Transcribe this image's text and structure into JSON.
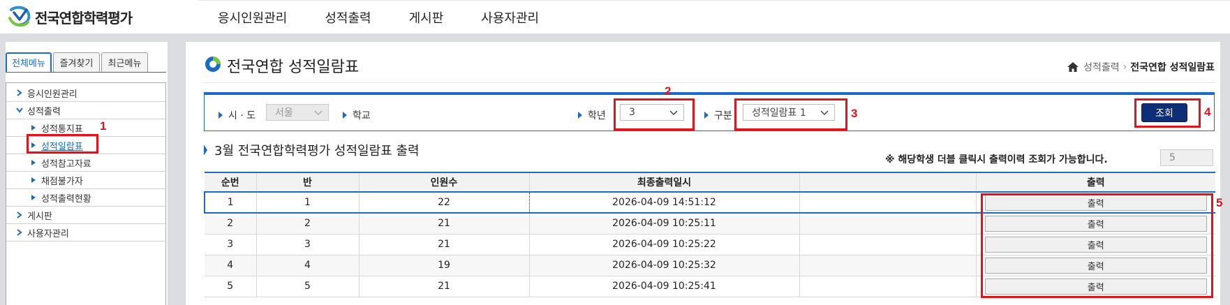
{
  "header": {
    "logo_text": "전국연합학력평가",
    "nav": [
      "응시인원관리",
      "성적출력",
      "게시판",
      "사용자관리"
    ]
  },
  "sidebar": {
    "tabs": [
      "전체메뉴",
      "즐겨찾기",
      "최근메뉴"
    ],
    "menu": [
      {
        "label": "응시인원관리",
        "level": 1,
        "expanded": false
      },
      {
        "label": "성적출력",
        "level": 1,
        "expanded": true
      },
      {
        "label": "성적통지표",
        "level": 2
      },
      {
        "label": "성적일람표",
        "level": 2,
        "selected": true
      },
      {
        "label": "성적참고자료",
        "level": 2
      },
      {
        "label": "채점불가자",
        "level": 2
      },
      {
        "label": "성적출력현황",
        "level": 2
      },
      {
        "label": "게시판",
        "level": 1,
        "expanded": false
      },
      {
        "label": "사용자관리",
        "level": 1,
        "expanded": false
      }
    ]
  },
  "page": {
    "title": "전국연합 성적일람표",
    "breadcrumb": [
      "성적출력",
      "전국연합 성적일람표"
    ]
  },
  "filter": {
    "sido_label": "시 · 도",
    "sido_value": "서울",
    "school_label": "학교",
    "grade_label": "학년",
    "grade_value": "3",
    "type_label": "구분",
    "type_value": "성적일람표 1",
    "search_label": "조회"
  },
  "result": {
    "subtitle": "3월 전국연합학력평가 성적일람표 출력",
    "notice": "※ 해당학생 더블 클릭시 출력이력 조회가 가능합니다.",
    "page_size": "5",
    "columns": [
      "순번",
      "반",
      "인원수",
      "최종출력일시",
      "",
      "출력"
    ],
    "rows": [
      {
        "no": "1",
        "ban": "1",
        "count": "22",
        "datetime": "2026-04-09 14:51:12",
        "button": "출력"
      },
      {
        "no": "2",
        "ban": "2",
        "count": "21",
        "datetime": "2026-04-09 10:25:11",
        "button": "출력"
      },
      {
        "no": "3",
        "ban": "3",
        "count": "21",
        "datetime": "2026-04-09 10:25:22",
        "button": "출력"
      },
      {
        "no": "4",
        "ban": "4",
        "count": "19",
        "datetime": "2026-04-09 10:25:32",
        "button": "출력"
      },
      {
        "no": "5",
        "ban": "5",
        "count": "21",
        "datetime": "2026-04-09 10:25:41",
        "button": "출력"
      }
    ]
  },
  "annotations": [
    "1",
    "2",
    "3",
    "4",
    "5"
  ],
  "colors": {
    "accent": "#1c6bc2",
    "highlight": "#e0121b",
    "button_dark": "#0e2f78"
  }
}
